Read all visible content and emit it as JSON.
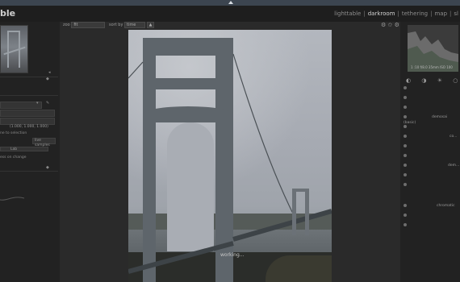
{
  "app": {
    "logo_text": "ble"
  },
  "views": [
    {
      "label": "lighttable",
      "current": false
    },
    {
      "label": "darkroom",
      "current": true
    },
    {
      "label": "tethering",
      "current": false
    },
    {
      "label": "map",
      "current": false
    },
    {
      "label": "sl",
      "current": false
    }
  ],
  "toolbar": {
    "zoom_label": "zoo",
    "zoom_value": "fit",
    "sort_label": "sort by",
    "sort_value": "time",
    "sort_dir": "▲",
    "icons": [
      "gear-icon",
      "star-icon",
      "filter-icon"
    ]
  },
  "left_panel": {
    "expander": "◂",
    "picker_values": "(1.000, 1.000, 1.000)",
    "to_selection": "ne to selection",
    "live_samples": "live samples",
    "sample_mode": "Lab",
    "compress_text": "ess on change",
    "rows": [
      "",
      "",
      "",
      ""
    ]
  },
  "photo": {
    "status": "working..."
  },
  "right_panel": {
    "histogram_caption": "1 :10 f/8.0 35mm ISO 100",
    "modules": [
      {
        "label": ""
      },
      {
        "label": ""
      },
      {
        "label": ""
      },
      {
        "label": "demosai (basic)"
      },
      {
        "label": ""
      },
      {
        "label": "co..."
      },
      {
        "label": ""
      },
      {
        "label": ""
      },
      {
        "label": "dem..."
      },
      {
        "label": ""
      },
      {
        "label": ""
      },
      {
        "label": "chromatic"
      },
      {
        "label": ""
      },
      {
        "label": ""
      }
    ],
    "tab_icons": [
      "circle-icon",
      "contrast-icon",
      "sun-icon",
      "circle-outline-icon",
      "gear-icon"
    ]
  }
}
